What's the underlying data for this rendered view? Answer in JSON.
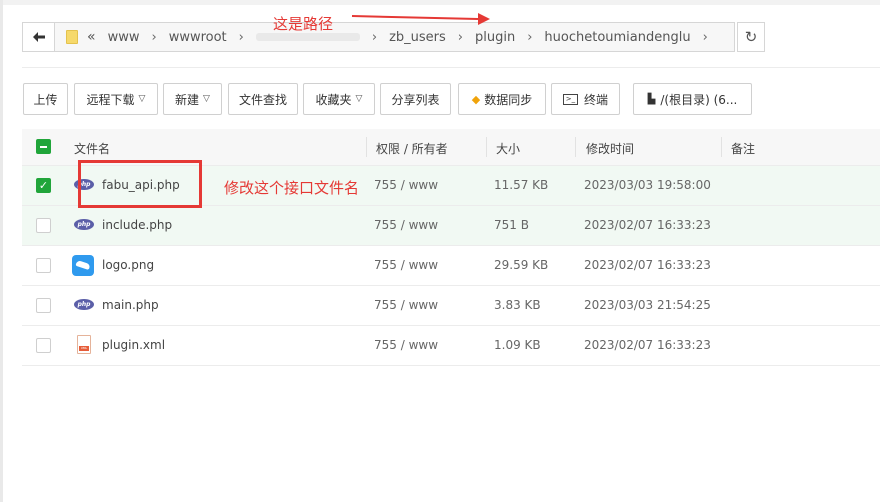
{
  "breadcrumb": [
    "www",
    "wwwroot",
    "zb_users",
    "plugin",
    "huochetoumiandenglu"
  ],
  "annotations": {
    "path_note": "这是路径",
    "edit_note": "修改这个接口文件名"
  },
  "toolbar": {
    "upload": "上传",
    "remote_download": "远程下载",
    "new": "新建",
    "file_search": "文件查找",
    "favorites": "收藏夹",
    "share_list": "分享列表",
    "data_sync": "数据同步",
    "terminal": "终端",
    "root_dir": "/(根目录) (6..."
  },
  "table": {
    "headers": {
      "name": "文件名",
      "perm": "权限 / 所有者",
      "size": "大小",
      "mtime": "修改时间",
      "note": "备注"
    },
    "rows": [
      {
        "name": "fabu_api.php",
        "perm": "755 / www",
        "size": "11.57 KB",
        "mtime": "2023/03/03 19:58:00",
        "icon": "php-file-icon",
        "checked": true
      },
      {
        "name": "include.php",
        "perm": "755 / www",
        "size": "751 B",
        "mtime": "2023/02/07 16:33:23",
        "icon": "php-file-icon",
        "checked": false
      },
      {
        "name": "logo.png",
        "perm": "755 / www",
        "size": "29.59 KB",
        "mtime": "2023/02/07 16:33:23",
        "icon": "image-file-icon",
        "checked": false
      },
      {
        "name": "main.php",
        "perm": "755 / www",
        "size": "3.83 KB",
        "mtime": "2023/03/03 21:54:25",
        "icon": "php-file-icon",
        "checked": false
      },
      {
        "name": "plugin.xml",
        "perm": "755 / www",
        "size": "1.09 KB",
        "mtime": "2023/02/07 16:33:23",
        "icon": "xml-file-icon",
        "checked": false
      }
    ]
  },
  "colors": {
    "accent": "#20a53a",
    "annotation": "#e53935"
  }
}
